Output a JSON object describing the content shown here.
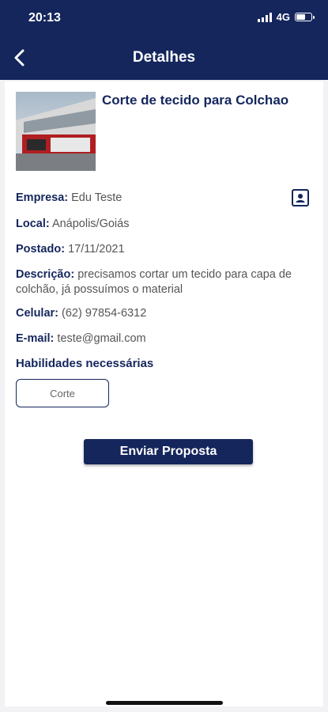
{
  "status": {
    "time": "20:13",
    "network": "4G"
  },
  "header": {
    "title": "Detalhes"
  },
  "job": {
    "title": "Corte de tecido para Colchao",
    "empresa_label": "Empresa:",
    "empresa": "Edu Teste",
    "local_label": "Local:",
    "local": "Anápolis/Goiás",
    "postado_label": "Postado:",
    "postado": "17/11/2021",
    "descricao_label": "Descrição:",
    "descricao": "precisamos cortar um tecido para capa de colchão, já possuímos o material",
    "celular_label": "Celular:",
    "celular": "(62) 97854-6312",
    "email_label": "E-mail:",
    "email": "teste@gmail.com"
  },
  "skills": {
    "heading": "Habilidades necessárias",
    "items": [
      "Corte"
    ]
  },
  "actions": {
    "send_label": "Enviar Proposta"
  },
  "colors": {
    "primary": "#14265c",
    "background": "#f2f2f4"
  }
}
